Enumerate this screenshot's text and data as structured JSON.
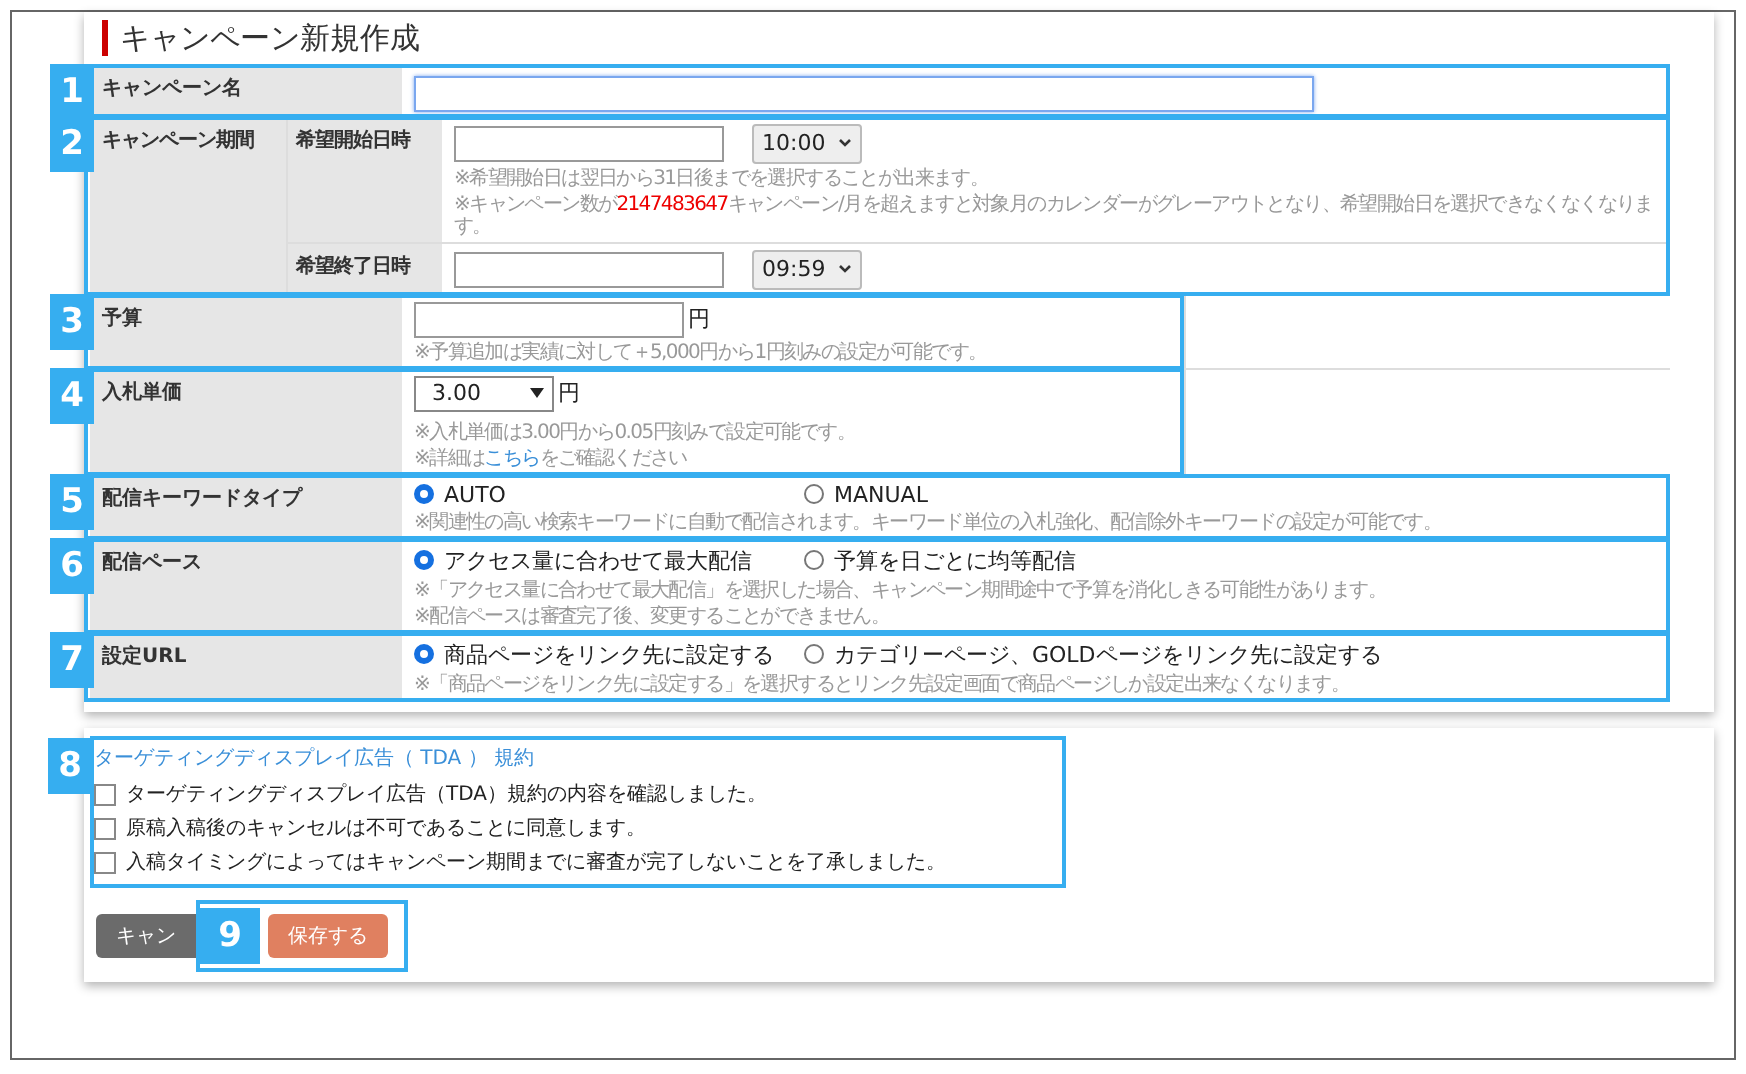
{
  "title": "キャンペーン新規作成",
  "campaign_name": {
    "marker": "1",
    "label": "キャンペーン名",
    "focused": true
  },
  "campaign_period": {
    "marker": "2",
    "label": "キャンペーン期間",
    "start": {
      "label": "希望開始日時",
      "time": "10:00",
      "notes": [
        {
          "before": "※希望開始日は翌日から31日後までを選択することが出来ます。"
        },
        {
          "before": "※キャンペーン数が",
          "highlight": "2147483647",
          "after": "キャンペーン/月を超えますと対象月のカレンダーがグレーアウトとなり、希望開始日を選択できなくなくなります。"
        }
      ]
    },
    "end": {
      "label": "希望終了日時",
      "time": "09:59"
    }
  },
  "budget": {
    "marker": "3",
    "label": "予算",
    "unit": "円",
    "notes": [
      "※予算追加は実績に対して＋5,000円から1円刻みの設定が可能です。"
    ]
  },
  "bid": {
    "marker": "4",
    "label": "入札単価",
    "value": "3.00",
    "unit": "円",
    "notes": [
      "※入札単価は3.00円から0.05円刻みで設定可能です。"
    ],
    "detail": {
      "before": "※詳細は",
      "link": "こちら",
      "after": "をご確認ください"
    }
  },
  "keyword_type": {
    "marker": "5",
    "label": "配信キーワードタイプ",
    "options": [
      {
        "label": "AUTO",
        "selected": true
      },
      {
        "label": "MANUAL",
        "selected": false
      }
    ],
    "notes": [
      "※関連性の高い検索キーワードに自動で配信されます。キーワード単位の入札強化、配信除外キーワードの設定が可能です。"
    ]
  },
  "pace": {
    "marker": "6",
    "label": "配信ペース",
    "options": [
      {
        "label": "アクセス量に合わせて最大配信",
        "selected": true
      },
      {
        "label": "予算を日ごとに均等配信",
        "selected": false
      }
    ],
    "notes": [
      "※「アクセス量に合わせて最大配信」を選択した場合、キャンペーン期間途中で予算を消化しきる可能性があります。",
      "※配信ペースは審査完了後、変更することができません。"
    ]
  },
  "url": {
    "marker": "7",
    "label": "設定URL",
    "options": [
      {
        "label": "商品ページをリンク先に設定する",
        "selected": true
      },
      {
        "label": "カテゴリーページ、GOLDページをリンク先に設定する",
        "selected": false
      }
    ],
    "notes": [
      "※「商品ページをリンク先に設定する」を選択するとリンク先設定画面で商品ページしか設定出来なくなります。"
    ]
  },
  "terms": {
    "marker": "8",
    "link": "ターゲティングディスプレイ広告（ TDA ） 規約",
    "items": [
      {
        "label": "ターゲティングディスプレイ広告（TDA）規約の内容を確認しました。",
        "checked": false
      },
      {
        "label": "原稿入稿後のキャンセルは不可であることに同意します。",
        "checked": false
      },
      {
        "label": "入稿タイミングによってはキャンペーン期間までに審査が完了しないことを了承しました。",
        "checked": false
      }
    ]
  },
  "buttons": {
    "marker": "9",
    "cancel": "キャン",
    "save": "保存する"
  }
}
